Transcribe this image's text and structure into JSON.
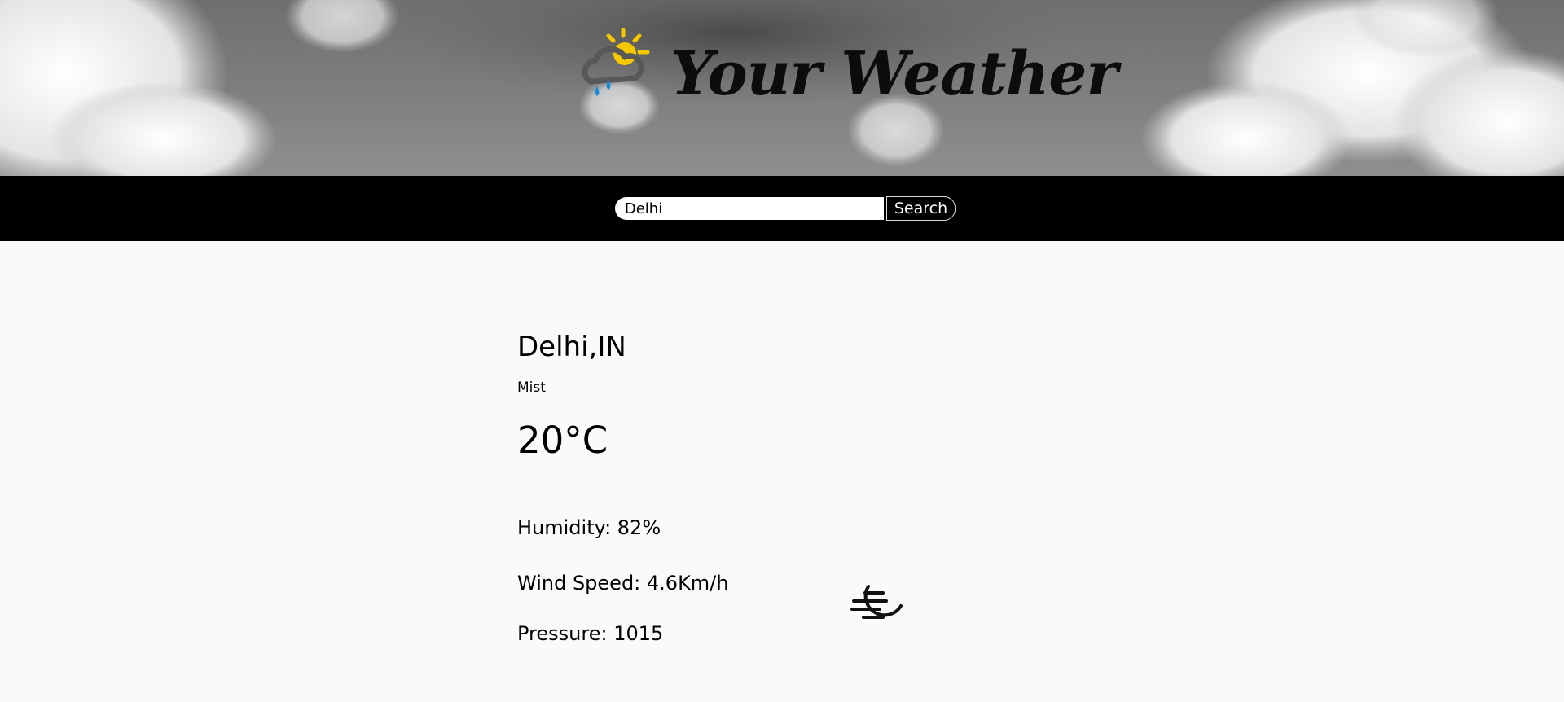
{
  "header": {
    "title": "Your Weather",
    "logo_icon": "cloud-sun-rain-icon",
    "sun_color": "#f5c800",
    "rain_color": "#1a8ad4"
  },
  "search": {
    "value": "Delhi",
    "button_label": "Search"
  },
  "weather": {
    "location": "Delhi,IN",
    "description": "Mist",
    "temperature": "20°C",
    "humidity": "Humidity: 82%",
    "wind_speed": "Wind Speed: 4.6Km/h",
    "pressure": "Pressure: 1015",
    "condition_icon": "wind-moon-icon"
  }
}
